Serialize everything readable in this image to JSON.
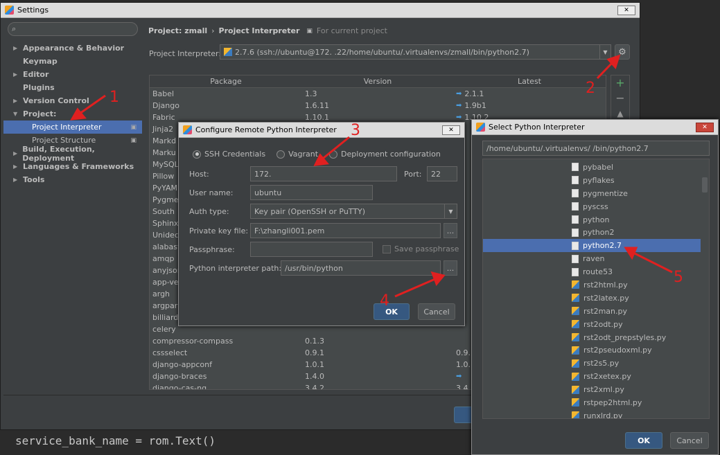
{
  "settings": {
    "title": "Settings",
    "search_placeholder": "",
    "sidebar": [
      {
        "label": "Appearance & Behavior",
        "arrow": "▶"
      },
      {
        "label": "Keymap",
        "arrow": ""
      },
      {
        "label": "Editor",
        "arrow": "▶"
      },
      {
        "label": "Plugins",
        "arrow": ""
      },
      {
        "label": "Version Control",
        "arrow": "▶"
      },
      {
        "label": "Project: ",
        "arrow": "▼"
      }
    ],
    "sub_items": [
      "Project Interpreter",
      "Project Structure"
    ],
    "sidebar_bottom": [
      {
        "label": "Build, Execution, Deployment",
        "arrow": "▶"
      },
      {
        "label": "Languages & Frameworks",
        "arrow": "▶"
      },
      {
        "label": "Tools",
        "arrow": "▶"
      }
    ],
    "breadcrumb_project": "Project: zmall",
    "breadcrumb_sep": "›",
    "breadcrumb_page": "Project Interpreter",
    "breadcrumb_note": "For current project",
    "interpreter_label": "Project Interpreter:",
    "interpreter_value": "2.7.6 (ssh://ubuntu@172.           .22/home/ubuntu/.virtualenvs/zmall/bin/python2.7)",
    "columns": [
      "Package",
      "Version",
      "Latest"
    ],
    "packages": [
      {
        "name": "Babel",
        "version": "1.3",
        "latest": "2.1.1",
        "upgrade": true
      },
      {
        "name": "Django",
        "version": "1.6.11",
        "latest": "1.9b1",
        "upgrade": true
      },
      {
        "name": "Fabric",
        "version": "1.10.1",
        "latest": "1.10.2",
        "upgrade": true
      },
      {
        "name": "Jinja2",
        "version": "",
        "latest": "",
        "upgrade": false
      },
      {
        "name": "Markd",
        "version": "",
        "latest": "",
        "upgrade": false
      },
      {
        "name": "Marku",
        "version": "",
        "latest": "",
        "upgrade": false
      },
      {
        "name": "MySQL",
        "version": "",
        "latest": "",
        "upgrade": false
      },
      {
        "name": "Pillow",
        "version": "",
        "latest": "",
        "upgrade": false
      },
      {
        "name": "PyYAM",
        "version": "",
        "latest": "",
        "upgrade": false
      },
      {
        "name": "Pygme",
        "version": "",
        "latest": "",
        "upgrade": false
      },
      {
        "name": "South",
        "version": "",
        "latest": "",
        "upgrade": false
      },
      {
        "name": "Sphinx",
        "version": "",
        "latest": "",
        "upgrade": false
      },
      {
        "name": "Unidec",
        "version": "",
        "latest": "",
        "upgrade": false
      },
      {
        "name": "alabast",
        "version": "",
        "latest": "",
        "upgrade": false
      },
      {
        "name": "amqp",
        "version": "",
        "latest": "",
        "upgrade": false
      },
      {
        "name": "anyjson",
        "version": "",
        "latest": "",
        "upgrade": false
      },
      {
        "name": "app-ve",
        "version": "",
        "latest": "",
        "upgrade": false
      },
      {
        "name": "argh",
        "version": "",
        "latest": "",
        "upgrade": false
      },
      {
        "name": "argpar",
        "version": "",
        "latest": "",
        "upgrade": false
      },
      {
        "name": "billiard",
        "version": "",
        "latest": "",
        "upgrade": false
      },
      {
        "name": "celery",
        "version": "",
        "latest": "",
        "upgrade": false
      },
      {
        "name": "compressor-compass",
        "version": "0.1.3",
        "latest": "",
        "upgrade": false
      },
      {
        "name": "cssselect",
        "version": "0.9.1",
        "latest": "0.9.",
        "upgrade": false
      },
      {
        "name": "django-appconf",
        "version": "1.0.1",
        "latest": "1.0.",
        "upgrade": false
      },
      {
        "name": "django-braces",
        "version": "1.4.0",
        "latest": "",
        "upgrade": true
      },
      {
        "name": "django-cas-ng",
        "version": "3.4.2",
        "latest": "3.4.",
        "upgrade": false
      }
    ]
  },
  "code_line": "service_bank_name = rom.Text()",
  "remote": {
    "title": "Configure Remote Python Interpreter",
    "radio_ssh": "SSH Credentials",
    "radio_vagrant": "Vagrant",
    "radio_deploy": "Deployment configuration",
    "host_label": "Host:",
    "host_value": "172.",
    "port_label": "Port:",
    "port_value": "22",
    "user_label": "User name:",
    "user_value": "ubuntu",
    "auth_label": "Auth type:",
    "auth_value": "Key pair (OpenSSH or PuTTY)",
    "key_label": "Private key file:",
    "key_value": "F:\\zhangli001.pem",
    "pass_label": "Passphrase:",
    "save_pass": "Save passphrase",
    "path_label": "Python interpreter path:",
    "path_value": "/usr/bin/python",
    "browse": "...",
    "ok": "OK",
    "cancel": "Cancel"
  },
  "selector": {
    "title": "Select Python Interpreter",
    "path_value": "/home/ubuntu/.virtualenvs/            /bin/python2.7",
    "files": [
      {
        "name": "pybabel",
        "type": "file"
      },
      {
        "name": "pyflakes",
        "type": "file"
      },
      {
        "name": "pygmentize",
        "type": "file"
      },
      {
        "name": "pyscss",
        "type": "file"
      },
      {
        "name": "python",
        "type": "file"
      },
      {
        "name": "python2",
        "type": "file"
      },
      {
        "name": "python2.7",
        "type": "file",
        "selected": true
      },
      {
        "name": "raven",
        "type": "file"
      },
      {
        "name": "route53",
        "type": "file"
      },
      {
        "name": "rst2html.py",
        "type": "py"
      },
      {
        "name": "rst2latex.py",
        "type": "py"
      },
      {
        "name": "rst2man.py",
        "type": "py"
      },
      {
        "name": "rst2odt.py",
        "type": "py"
      },
      {
        "name": "rst2odt_prepstyles.py",
        "type": "py"
      },
      {
        "name": "rst2pseudoxml.py",
        "type": "py"
      },
      {
        "name": "rst2s5.py",
        "type": "py"
      },
      {
        "name": "rst2xetex.py",
        "type": "py"
      },
      {
        "name": "rst2xml.py",
        "type": "py"
      },
      {
        "name": "rstpep2html.py",
        "type": "py"
      },
      {
        "name": "runxlrd.py",
        "type": "py"
      }
    ],
    "ok": "OK",
    "cancel": "Cancel"
  },
  "annotations": [
    "1",
    "2",
    "3",
    "4",
    "5"
  ],
  "colors": {
    "selection": "#4b6eaf",
    "accent": "#365880",
    "annotation": "#e02020"
  }
}
